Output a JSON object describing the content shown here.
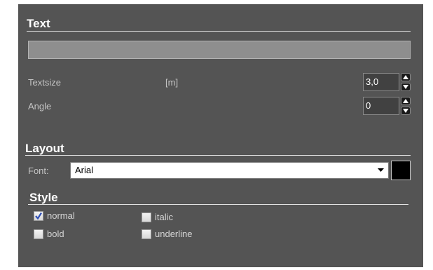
{
  "text_section": {
    "title": "Text",
    "text_value": "",
    "textsize": {
      "label": "Textsize",
      "unit": "[m]",
      "value": "3,0"
    },
    "angle": {
      "label": "Angle",
      "value": "0"
    }
  },
  "layout_section": {
    "title": "Layout",
    "font_label": "Font:",
    "font_value": "Arial",
    "font_color": "#000000"
  },
  "style_section": {
    "title": "Style",
    "options": [
      {
        "label": "normal",
        "checked": true
      },
      {
        "label": "italic",
        "checked": false
      },
      {
        "label": "bold",
        "checked": false
      },
      {
        "label": "underline",
        "checked": false
      }
    ]
  },
  "icons": {
    "spin_up": "arrow-up-icon",
    "spin_down": "arrow-down-icon",
    "dropdown": "chevron-down-icon",
    "check": "checkmark-icon"
  },
  "colors": {
    "panel_background": "#545454",
    "check_mark": "#2f4fb6"
  }
}
